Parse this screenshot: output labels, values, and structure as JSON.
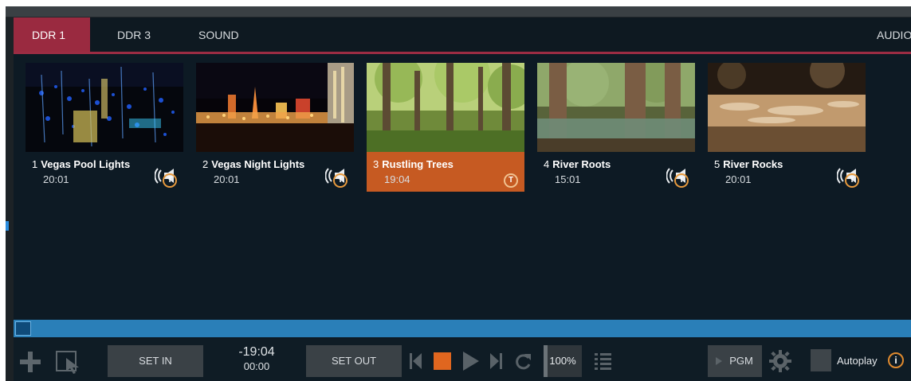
{
  "tabs": [
    {
      "label": "DDR 1",
      "active": true
    },
    {
      "label": "DDR 3",
      "active": false
    },
    {
      "label": "SOUND",
      "active": false
    },
    {
      "label": "AUDIO",
      "active": false
    }
  ],
  "clips": [
    {
      "number": "1",
      "name": "Vegas Pool Lights",
      "duration": "20:01",
      "badge": "T",
      "selected": false
    },
    {
      "number": "2",
      "name": "Vegas Night Lights",
      "duration": "20:01",
      "badge": "T",
      "selected": false
    },
    {
      "number": "3",
      "name": "Rustling Trees",
      "duration": "19:04",
      "badge": "T",
      "selected": true
    },
    {
      "number": "4",
      "name": "River Roots",
      "duration": "15:01",
      "badge": "T",
      "selected": false
    },
    {
      "number": "5",
      "name": "River Rocks",
      "duration": "20:01",
      "badge": "T",
      "selected": false
    }
  ],
  "toolbar": {
    "set_in": "SET IN",
    "set_out": "SET OUT",
    "timecode_remaining": "-19:04",
    "timecode_elapsed": "00:00",
    "zoom": "100%",
    "pgm": "PGM",
    "autoplay": "Autoplay",
    "info": "i"
  },
  "icons": [
    "add-icon",
    "select-icon",
    "previous-icon",
    "stop-icon",
    "play-icon",
    "next-icon",
    "loop-icon",
    "playlist-icon",
    "pgm-arrow-icon",
    "gear-icon",
    "speaker-icon"
  ],
  "colors": {
    "accent": "#9a2a40",
    "selected_clip": "#c65a22",
    "stop": "#e0661f",
    "scrub": "#2a7fb8",
    "badge": "#e79a3e"
  }
}
